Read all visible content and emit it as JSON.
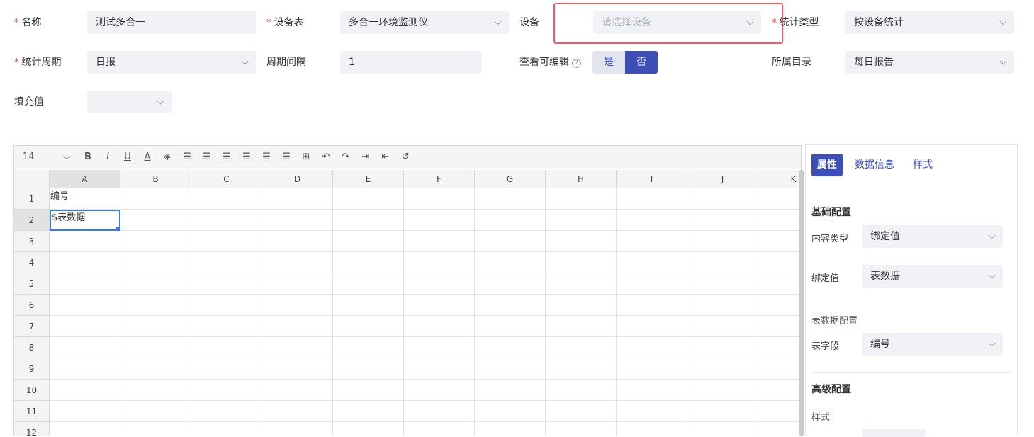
{
  "form": {
    "name_label": "名称",
    "name_value": "测试多合一",
    "device_table_label": "设备表",
    "device_table_value": "多合一环境监测仪",
    "device_label": "设备",
    "device_placeholder": "请选择设备",
    "stat_type_label": "统计类型",
    "stat_type_value": "按设备统计",
    "period_label": "统计周期",
    "period_value": "日报",
    "interval_label": "周期间隔",
    "interval_value": "1",
    "editable_label": "查看可编辑",
    "editable_help": "?",
    "editable_yes": "是",
    "editable_no": "否",
    "editable_selected": "否",
    "dir_label": "所属目录",
    "dir_value": "每日报告",
    "fill_label": "填充值",
    "fill_value": "",
    "required_mark": "*"
  },
  "toolbar": {
    "font_size": "14",
    "icons": [
      "dropdown-icon",
      "bold-icon",
      "italic-icon",
      "underline-icon",
      "font-color-icon",
      "fill-color-icon",
      "align-left-icon",
      "align-center-icon",
      "align-right-icon",
      "valign-top-icon",
      "valign-middle-icon",
      "valign-bottom-icon",
      "merge-cells-icon",
      "undo-icon",
      "redo-icon",
      "insert-column-icon",
      "insert-row-icon",
      "reset-icon"
    ],
    "bold": "B",
    "italic": "I",
    "underline": "U",
    "font_color": "A"
  },
  "sheet": {
    "columns": [
      "A",
      "B",
      "C",
      "D",
      "E",
      "F",
      "G",
      "H",
      "I",
      "J",
      "K"
    ],
    "rows": [
      "1",
      "2",
      "3",
      "4",
      "5",
      "6",
      "7",
      "8",
      "9",
      "10",
      "11",
      "12"
    ],
    "cells": {
      "A1": "编号",
      "A2": "$表数据"
    },
    "selected_cell": "A2"
  },
  "panel": {
    "tabs": [
      "属性",
      "数据信息",
      "样式"
    ],
    "active_tab": "属性",
    "basic_title": "基础配置",
    "content_type_label": "内容类型",
    "content_type_value": "绑定值",
    "bind_value_label": "绑定值",
    "bind_value_value": "表数据",
    "table_data_title": "表数据配置",
    "table_field_label": "表字段",
    "table_field_value": "编号",
    "advanced_title": "高级配置",
    "style_label": "样式"
  },
  "colors": {
    "primary": "#3d4fb5",
    "required": "#e0393e",
    "highlight": "#e5606b",
    "input_bg": "#f0f2f5"
  }
}
